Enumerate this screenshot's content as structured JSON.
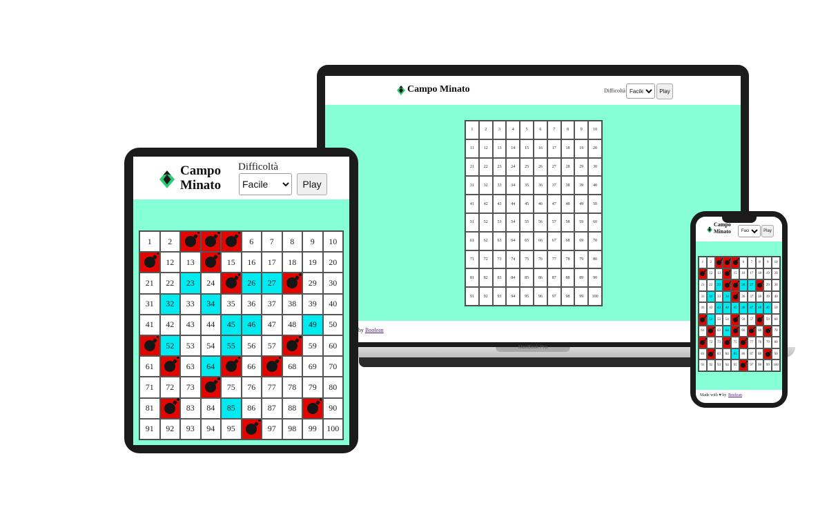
{
  "app": {
    "title": "Campo Minato",
    "title_line1": "Campo",
    "title_line2": "Minato",
    "difficulty_label_laptop": "Difficoltà",
    "difficulty_label_tablet": "Difficoltà",
    "difficulty_value": "Facile",
    "play_label": "Play",
    "footer_made": "Made with ♥ by ",
    "footer_author": "Boolean",
    "laptop_footer_prefix": "by ",
    "device_brand": "MacBook Pro"
  },
  "colors": {
    "header_bg": "#ffffff",
    "main_bg": "#86ffd6",
    "bomb_cell": "#e10600",
    "safe_revealed": "#00eaf0",
    "logo_green": "#2ecc71",
    "logo_dark": "#1a1a1a"
  },
  "grid": {
    "size": 100,
    "columns": 10,
    "bombs": [
      3,
      4,
      5,
      11,
      14,
      25,
      28,
      51,
      58,
      62,
      65,
      67,
      74,
      82,
      89,
      96
    ],
    "revealed_safe": [
      23,
      26,
      27,
      32,
      34,
      45,
      46,
      49,
      52,
      55,
      64,
      85
    ],
    "phone_extra_safe": [
      47,
      48,
      43,
      44
    ],
    "phone_bombs": [
      3,
      4,
      5,
      11,
      14,
      25,
      28,
      51,
      58,
      62,
      65,
      67,
      74,
      82,
      89,
      96,
      71,
      76,
      24,
      35,
      55,
      69
    ]
  },
  "icons": {
    "logo": "diamond-logo-icon",
    "bomb": "bomb-icon",
    "dropdown": "chevron-down-icon"
  }
}
